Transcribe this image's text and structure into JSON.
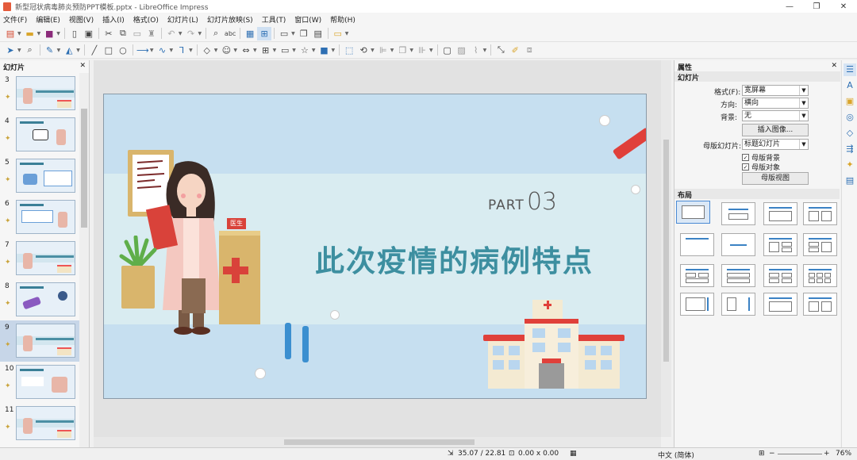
{
  "window": {
    "title": "新型冠状病毒肺炎预防PPT模板.pptx - LibreOffice Impress",
    "minimize": "—",
    "restore": "❐",
    "close": "✕"
  },
  "menu": [
    "文件(F)",
    "编辑(E)",
    "视图(V)",
    "插入(I)",
    "格式(O)",
    "幻灯片(L)",
    "幻灯片放映(S)",
    "工具(T)",
    "窗口(W)",
    "帮助(H)"
  ],
  "slides_panel": {
    "title": "幻灯片",
    "close": "✕",
    "thumbs": [
      {
        "num": "3",
        "selected": false
      },
      {
        "num": "4",
        "selected": false
      },
      {
        "num": "5",
        "selected": false
      },
      {
        "num": "6",
        "selected": false
      },
      {
        "num": "7",
        "selected": false
      },
      {
        "num": "8",
        "selected": false
      },
      {
        "num": "9",
        "selected": true
      },
      {
        "num": "10",
        "selected": false
      },
      {
        "num": "11",
        "selected": false
      }
    ]
  },
  "slide": {
    "part_word": "PART",
    "part_num": "03",
    "title": "此次疫情的病例特点",
    "sign": "医生"
  },
  "sidebar": {
    "title": "属性",
    "close": "✕",
    "section_slide": "幻灯片",
    "format_label": "格式(F):",
    "format_value": "宽屏幕",
    "orientation_label": "方向:",
    "orientation_value": "横向",
    "background_label": "背景:",
    "background_value": "无",
    "insert_image": "插入图像...",
    "master_label": "母版幻灯片:",
    "master_value": "标题幻灯片",
    "master_bg": "母版背景",
    "master_obj": "母版对象",
    "master_view": "母版视图",
    "section_layout": "布局"
  },
  "status": {
    "coords": "35.07 / 22.81",
    "size": "0.00 x 0.00",
    "lang": "中文 (简体)",
    "zoom": "76%"
  },
  "colors": {
    "title_teal": "#3d8fa0",
    "slide_bg": "#c6dff0",
    "accent_red": "#e0403a"
  }
}
